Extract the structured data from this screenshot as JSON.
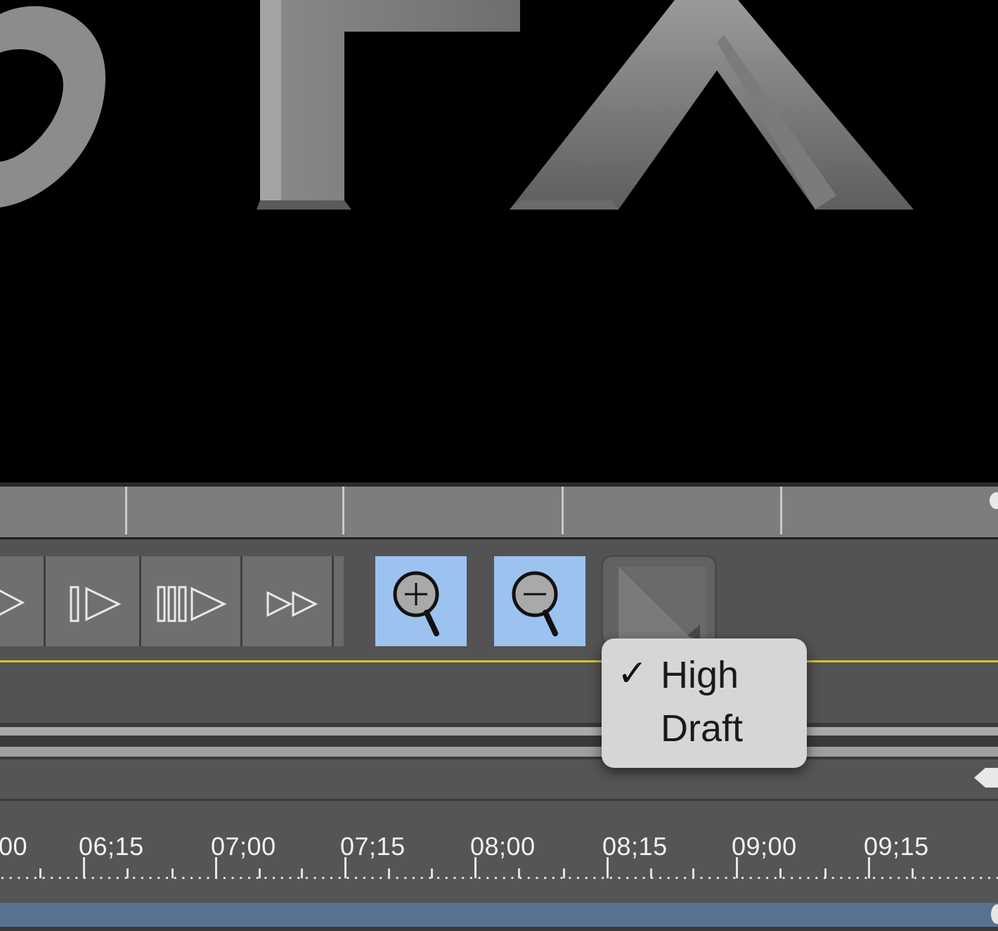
{
  "menu": {
    "items": [
      {
        "label": "High",
        "check": "✓"
      },
      {
        "label": "Draft",
        "check": ""
      }
    ]
  },
  "timecodes": [
    "00",
    "06;15",
    "07;00",
    "07;15",
    "08;00",
    "08;15",
    "09;00",
    "09;15"
  ],
  "icons": {
    "zoom_in": "zoom-in-icon",
    "zoom_out": "zoom-out-icon",
    "quality": "quality-menu-icon"
  },
  "colors": {
    "zoom_active": "#9cc3f0",
    "timeline_bar": "#587291",
    "playhead_line": "#d8c33a"
  }
}
